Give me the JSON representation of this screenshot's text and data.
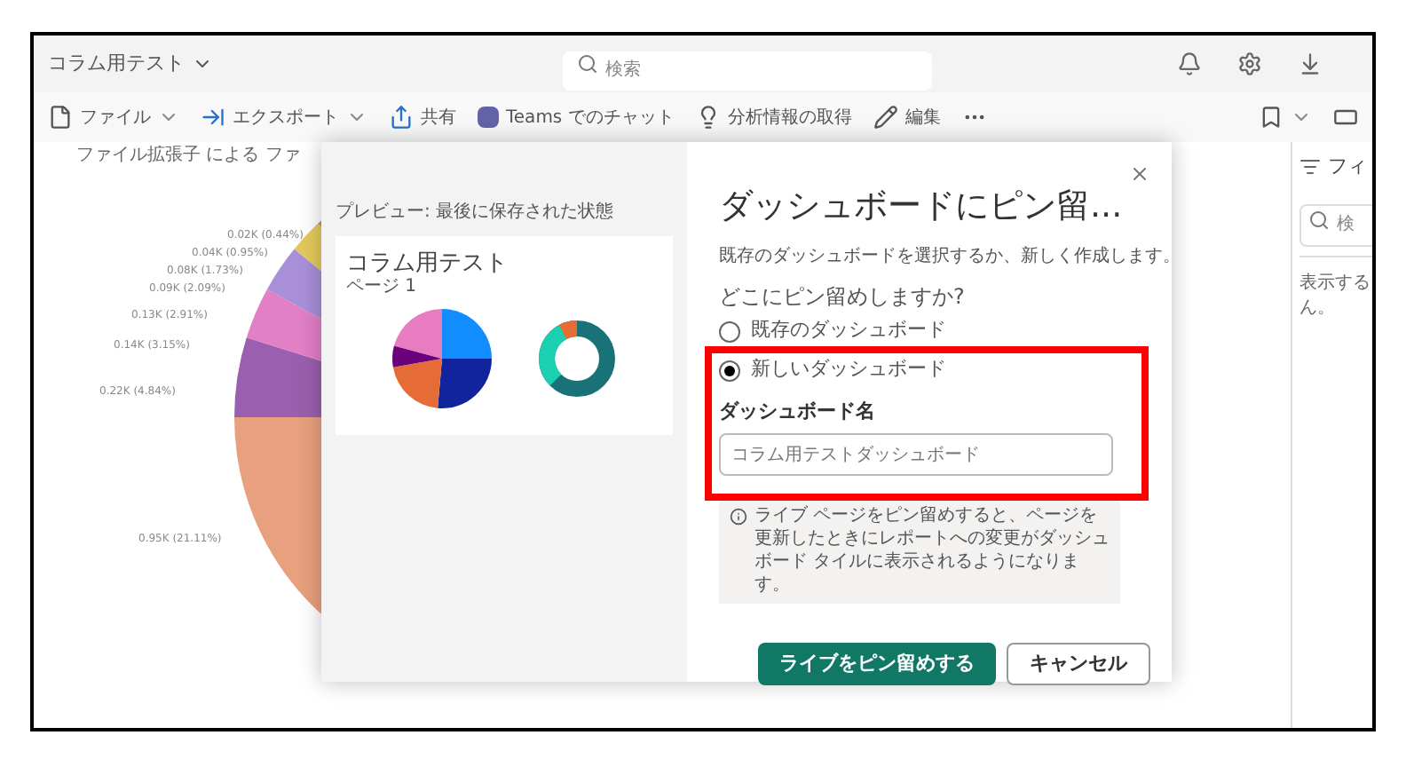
{
  "top_bar": {
    "report_title": "コラム用テスト",
    "search": {
      "placeholder": "検索"
    }
  },
  "toolbar": {
    "items": [
      {
        "label": "ファイル",
        "kind": "file",
        "dropdown": true
      },
      {
        "label": "エクスポート",
        "kind": "export",
        "dropdown": true
      },
      {
        "label": "共有",
        "kind": "share",
        "dropdown": false
      },
      {
        "label": "Teams でのチャット",
        "kind": "teams",
        "dropdown": false
      },
      {
        "label": "分析情報の取得",
        "kind": "insights",
        "dropdown": false
      },
      {
        "label": "編集",
        "kind": "edit",
        "dropdown": false
      }
    ]
  },
  "report": {
    "chart_title": "ファイル拡張子 による ファ",
    "slice_labels": [
      "0.02K (0.44%)",
      "0.04K (0.95%)",
      "0.08K (1.73%)",
      "0.09K (2.09%)",
      "0.13K (2.91%)",
      "0.14K (3.15%)",
      "0.22K (4.84%)",
      "0.95K (21.11%)"
    ]
  },
  "filters_pane": {
    "title": "フィ",
    "search": {
      "placeholder": "検"
    },
    "message_lines": [
      "表示する",
      "ん。"
    ]
  },
  "dialog": {
    "preview_label": "プレビュー: 最後に保存された状態",
    "preview": {
      "title": "コラム用テスト",
      "page": "ページ 1"
    },
    "title": "ダッシュボードにピン留...",
    "description": "既存のダッシュボードを選択するか、新しく作成します。",
    "question": "どこにピン留めしますか?",
    "options": [
      {
        "label": "既存のダッシュボード",
        "selected": false
      },
      {
        "label": "新しいダッシュボード",
        "selected": true
      }
    ],
    "name_label": "ダッシュボード名",
    "name_value": "コラム用テストダッシュボード",
    "info": "ライブ ページをピン留めすると、ページを更新したときにレポートへの変更がダッシュボード タイルに表示されるようになります。",
    "buttons": [
      {
        "label": "ライブをピン留めする",
        "kind": "primary"
      },
      {
        "label": "キャンセル",
        "kind": "secondary"
      }
    ]
  }
}
